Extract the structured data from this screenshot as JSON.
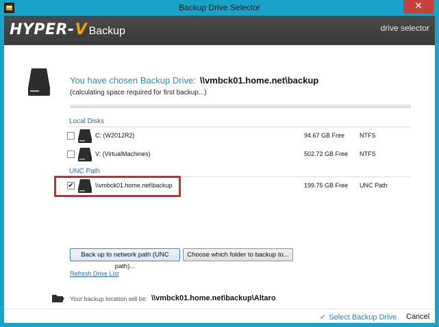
{
  "window": {
    "title": "Backup Drive Selector",
    "close_glyph": "✕"
  },
  "header": {
    "logo_hyper": "HYPER-",
    "logo_v": "V",
    "logo_backup": "Backup",
    "right_text": "drive selector"
  },
  "chosen": {
    "label": "You have chosen Backup Drive:",
    "path": "\\\\vmbck01.home.net\\backup",
    "status": "(calculating space required for first backup...)"
  },
  "local_disks": {
    "header": "Local Disks",
    "items": [
      {
        "name": "C: (W2012R2)",
        "free": "94.67 GB Free",
        "fs": "NTFS",
        "checked": false
      },
      {
        "name": "V: (VirtualMachines)",
        "free": "502.72 GB Free",
        "fs": "NTFS",
        "checked": false
      }
    ]
  },
  "unc": {
    "header": "UNC Path",
    "items": [
      {
        "name": "\\\\vmbck01.home.net\\backup",
        "free": "199.75 GB Free",
        "fs": "UNC Path",
        "checked": true,
        "check_glyph": "✔"
      }
    ]
  },
  "buttons": {
    "unc": "Back up to network path (UNC path)...",
    "folder": "Choose which folder to backup to..."
  },
  "refresh_link": "Refresh Drive List",
  "location": {
    "label": "Your backup location will be:",
    "path": "\\\\vmbck01.home.net\\backup\\Altaro"
  },
  "footer": {
    "select_check": "✔",
    "select_label": "Select Backup Drive",
    "cancel_label": "Cancel"
  },
  "colors": {
    "titlebar": "#1aa3c9",
    "accent_blue": "#2a8ab5",
    "highlight_red": "#d9262b",
    "logo_orange": "#f2a20d"
  },
  "icons": {
    "title": "hyperv-backup-app-icon",
    "drive": "hard-drive-icon",
    "folder": "folder-open-icon"
  }
}
